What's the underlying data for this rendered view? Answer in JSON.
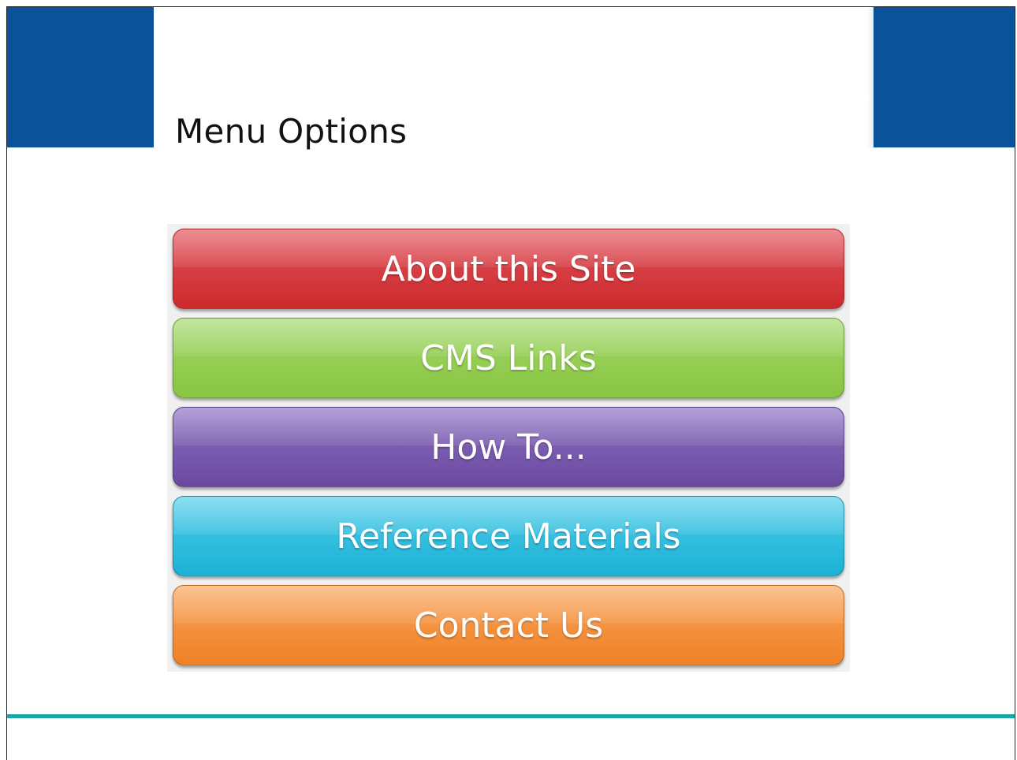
{
  "header": {
    "title": "Menu Options",
    "accent_color": "#0a5299"
  },
  "menu": {
    "items": [
      {
        "label": "About this Site",
        "color": "#d3393c"
      },
      {
        "label": "CMS Links",
        "color": "#92cd50"
      },
      {
        "label": "How To...",
        "color": "#7456a8"
      },
      {
        "label": "Reference Materials",
        "color": "#2bbbdc"
      },
      {
        "label": "Contact Us",
        "color": "#f28c36"
      }
    ]
  },
  "footer": {
    "line_color": "#1aa5a5"
  }
}
